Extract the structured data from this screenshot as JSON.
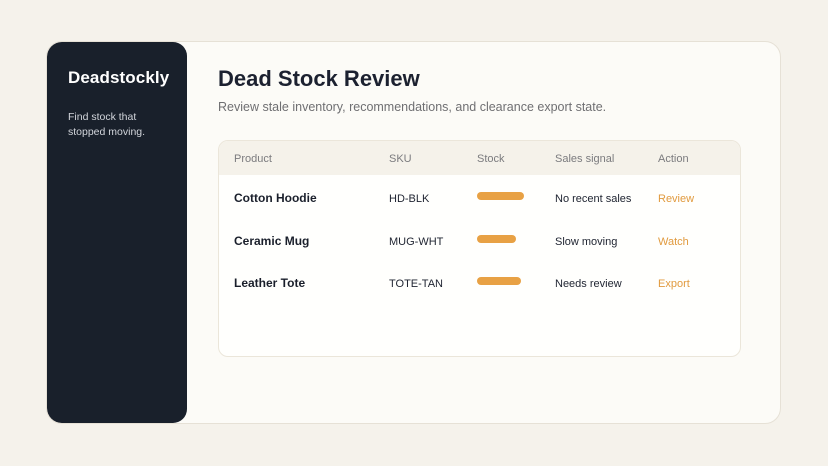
{
  "app": {
    "brand": "Deadstockly",
    "tagline": "Find stock that stopped moving."
  },
  "page": {
    "title": "Dead Stock Review",
    "subtitle": "Review stale inventory, recommendations, and clearance export state."
  },
  "table": {
    "headers": {
      "product": "Product",
      "sku": "SKU",
      "stock": "Stock",
      "signal": "Sales signal",
      "action": "Action"
    },
    "rows": [
      {
        "product": "Cotton Hoodie",
        "sku": "HD-BLK",
        "stock_level": 0.6,
        "signal": "No recent sales",
        "action": "Review"
      },
      {
        "product": "Ceramic Mug",
        "sku": "MUG-WHT",
        "stock_level": 0.5,
        "signal": "Slow moving",
        "action": "Watch"
      },
      {
        "product": "Leather Tote",
        "sku": "TOTE-TAN",
        "stock_level": 0.56,
        "signal": "Needs review",
        "action": "Export"
      }
    ]
  },
  "colors": {
    "sidebar_bg": "#19202b",
    "accent": "#e19a3e",
    "stock_bar": "#e8a144"
  }
}
